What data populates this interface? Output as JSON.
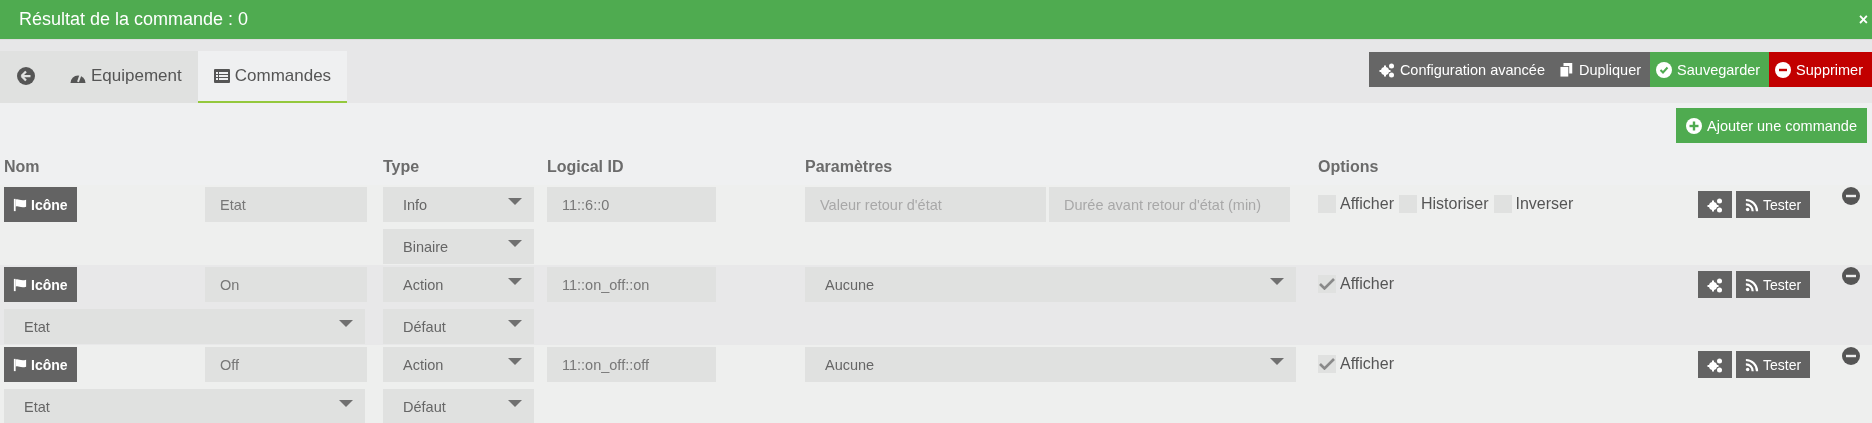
{
  "banner": {
    "text": "Résultat de la commande : 0",
    "close": "×"
  },
  "tabs": [
    {
      "kind": "back",
      "selected": false
    },
    {
      "kind": "equipment",
      "label": "Equipement",
      "selected": false
    },
    {
      "kind": "commands",
      "label": "Commandes",
      "selected": true
    }
  ],
  "actions": [
    {
      "kind": "config",
      "label": "Configuration avancée"
    },
    {
      "kind": "duplicate",
      "label": "Dupliquer"
    },
    {
      "kind": "save",
      "label": "Sauvegarder"
    },
    {
      "kind": "delete",
      "label": "Supprimer"
    }
  ],
  "add_button": "Ajouter une commande",
  "columns": [
    "Nom",
    "Type",
    "Logical ID",
    "Paramètres",
    "Options"
  ],
  "commands": [
    {
      "icon_button": "Icône",
      "name": "Etat",
      "type": "Info",
      "subtype": "Binaire",
      "logical_id": "11::6::0",
      "params": {
        "kind": "fields",
        "placeholders": [
          "Valeur retour d'état",
          "Durée avant retour d'état (min)"
        ]
      },
      "options": [
        {
          "label": "Afficher",
          "checked": false
        },
        {
          "label": "Historiser",
          "checked": false
        },
        {
          "label": "Inverser",
          "checked": false
        }
      ],
      "test": "Tester"
    },
    {
      "icon_button": "Icône",
      "name": "On",
      "type": "Action",
      "subtype": "Défaut",
      "value_link": "Etat",
      "logical_id": "11::on_off::on",
      "params": {
        "kind": "select",
        "value": "Aucune"
      },
      "options": [
        {
          "label": "Afficher",
          "checked": true
        }
      ],
      "test": "Tester"
    },
    {
      "icon_button": "Icône",
      "name": "Off",
      "type": "Action",
      "subtype": "Défaut",
      "value_link": "Etat",
      "logical_id": "11::on_off::off",
      "params": {
        "kind": "select",
        "value": "Aucune"
      },
      "options": [
        {
          "label": "Afficher",
          "checked": true
        }
      ],
      "test": "Tester"
    }
  ]
}
